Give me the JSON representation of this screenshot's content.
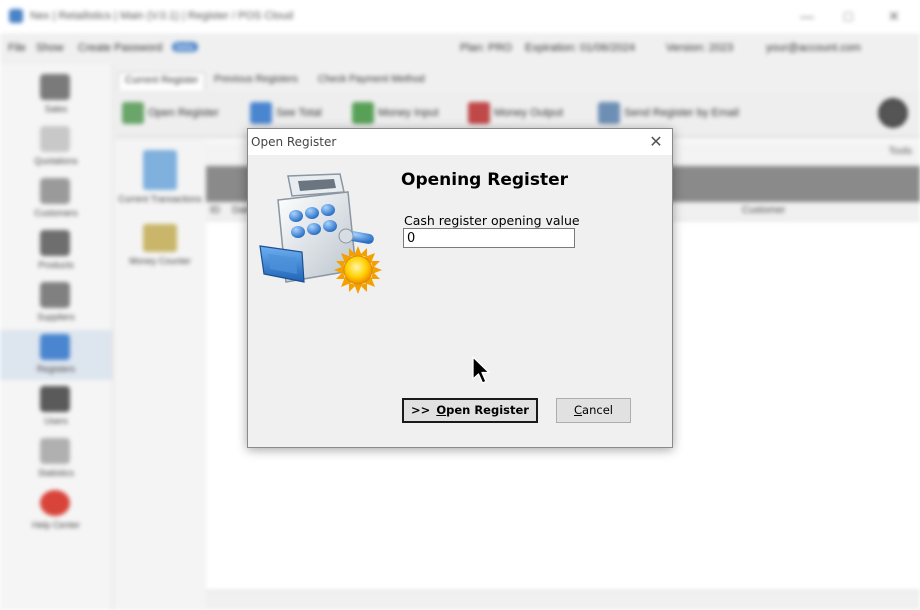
{
  "app": {
    "title": "Nex | Retailistics | Main (V.0.1) | Register / POS Cloud",
    "menu": [
      "File",
      "Show",
      "Create Password"
    ],
    "menu_badge": "beta",
    "status": {
      "plan": "Plan: PRO",
      "expiration": "Expiration: 01/06/2024",
      "version": "Version: 2023",
      "account": "your@account.com"
    },
    "nav_items": [
      {
        "label": "Sales",
        "icon": "cart-icon"
      },
      {
        "label": "Quotations",
        "icon": "document-icon"
      },
      {
        "label": "Customers",
        "icon": "customer-card-icon"
      },
      {
        "label": "Products",
        "icon": "box-icon"
      },
      {
        "label": "Suppliers",
        "icon": "truck-icon"
      },
      {
        "label": "Registers",
        "icon": "register-icon"
      },
      {
        "label": "Users",
        "icon": "users-icon"
      },
      {
        "label": "Statistics",
        "icon": "chart-icon"
      },
      {
        "label": "Help Center",
        "icon": "lifebuoy-icon"
      }
    ],
    "tabs": [
      "Current Register",
      "Previous Registers",
      "Check Payment Method"
    ],
    "toolbar": [
      "Open Register",
      "See Total",
      "Money Input",
      "Money Output",
      "Send Register by Email"
    ],
    "subnav": [
      "Current Transactions",
      "Money Counter"
    ],
    "content": {
      "search_right": "Tools",
      "columns": [
        "ID",
        "Date",
        "Customer"
      ]
    }
  },
  "dialog": {
    "title": "Open Register",
    "close_glyph": "✕",
    "heading": "Opening Register",
    "field_label": "Cash register opening value",
    "field_value": "0",
    "primary_button": {
      "arrows": ">>",
      "mnemonic": "O",
      "rest": "pen Register"
    },
    "cancel_button": {
      "mnemonic": "C",
      "rest": "ancel"
    }
  },
  "colors": {
    "dialog_bg": "#f0f0f0",
    "title_bg": "#ffffff",
    "register_blue": "#4a86d0",
    "sun_yellow": "#f5b800"
  }
}
